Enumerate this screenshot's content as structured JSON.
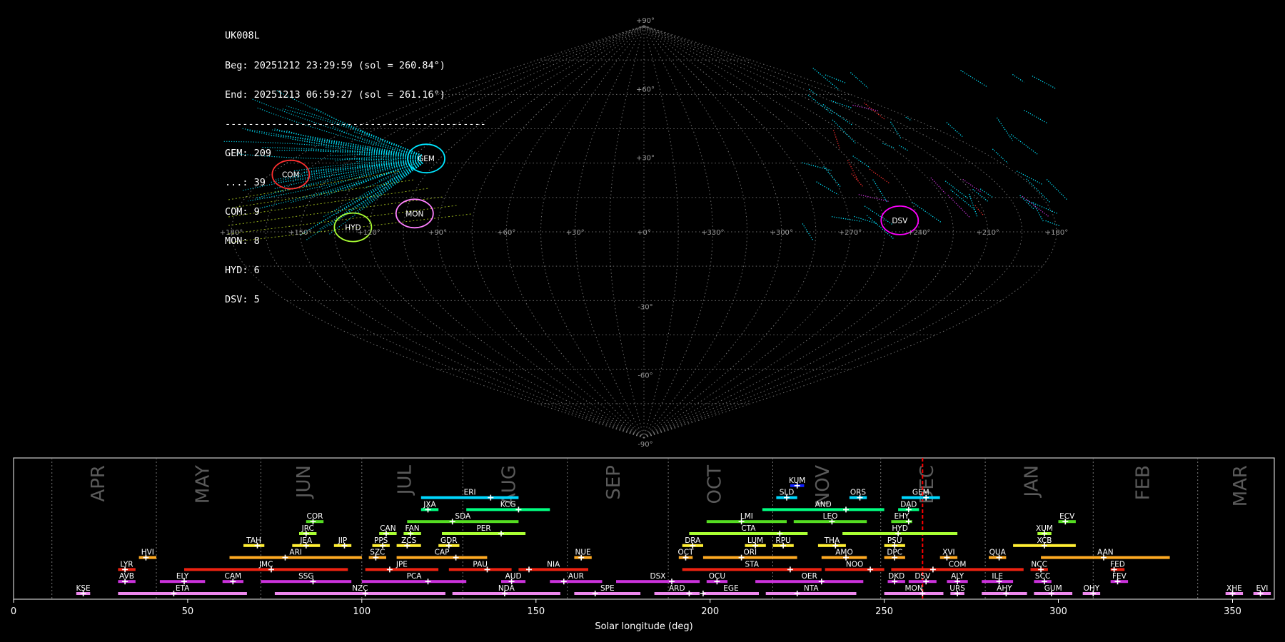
{
  "info": {
    "station": "UK008L",
    "begin": "Beg: 20251212 23:29:59 (sol = 260.84°)",
    "end": "End: 20251213 06:59:27 (sol = 261.16°)",
    "separator": "---------------------------------------------",
    "counts": [
      "GEM: 209",
      "...: 39",
      "COM: 9",
      "MON: 8",
      "HYD: 6",
      "DSV: 5"
    ]
  },
  "colors": {
    "background": "#000000",
    "grid": "#808080",
    "sporadic": "#00e5ff",
    "current_marker": "#ff0000",
    "text": "#ffffff",
    "month": "#5a5a5a"
  },
  "chart_data": [
    {
      "type": "scatter",
      "projection": "sinusoidal",
      "lon_labels": [
        "+180°",
        "+150°",
        "+120°",
        "+90°",
        "+60°",
        "+30°",
        "+0°",
        "+330°",
        "+300°",
        "+270°",
        "+240°",
        "+210°",
        "+180°"
      ],
      "lat_labels": [
        "+90°",
        "+60°",
        "+30°",
        "-30°",
        "-60°",
        "-90°"
      ],
      "radiants": [
        {
          "code": "COM",
          "ra": 170,
          "dec": 25,
          "color": "#ff3030"
        },
        {
          "code": "GEM",
          "ra": 112,
          "dec": 32,
          "color": "#00e5ff"
        },
        {
          "code": "MON",
          "ra": 101,
          "dec": 8,
          "color": "#ff80ff"
        },
        {
          "code": "HYD",
          "ra": 127,
          "dec": 2,
          "color": "#aaff33"
        },
        {
          "code": "DSV",
          "ra": 248,
          "dec": 5,
          "color": "#ff00ff"
        }
      ]
    },
    {
      "type": "bar",
      "xlabel": "Solar longitude (deg)",
      "xlim": [
        0,
        362
      ],
      "xticks": [
        0,
        50,
        100,
        150,
        200,
        250,
        300,
        350
      ],
      "current_sol": 261,
      "months": [
        {
          "name": "APR",
          "sol": 24
        },
        {
          "name": "MAY",
          "sol": 54
        },
        {
          "name": "JUN",
          "sol": 83
        },
        {
          "name": "JUL",
          "sol": 112
        },
        {
          "name": "AUG",
          "sol": 142
        },
        {
          "name": "SEP",
          "sol": 172
        },
        {
          "name": "OCT",
          "sol": 201
        },
        {
          "name": "NOV",
          "sol": 232
        },
        {
          "name": "DEC",
          "sol": 262
        },
        {
          "name": "JAN",
          "sol": 292
        },
        {
          "name": "FEB",
          "sol": 324
        },
        {
          "name": "MAR",
          "sol": 352
        }
      ],
      "month_bounds": [
        11,
        41,
        71,
        100,
        129,
        159,
        188,
        218,
        249,
        279,
        310,
        340
      ],
      "showers": [
        {
          "code": "KUM",
          "start": 223,
          "end": 227,
          "peak": 225,
          "row": 10,
          "color": "#1020ff"
        },
        {
          "code": "ERI",
          "start": 117,
          "end": 145,
          "peak": 137,
          "row": 9,
          "color": "#00d8ff"
        },
        {
          "code": "SLD",
          "start": 219,
          "end": 225,
          "peak": 222,
          "row": 9,
          "color": "#00d8ff"
        },
        {
          "code": "ORS",
          "start": 240,
          "end": 245,
          "peak": 243,
          "row": 9,
          "color": "#00d8ff"
        },
        {
          "code": "GEM",
          "start": 255,
          "end": 266,
          "peak": 262,
          "row": 9,
          "color": "#00d8ff"
        },
        {
          "code": "JXA",
          "start": 117,
          "end": 122,
          "peak": 119,
          "row": 8,
          "color": "#00ff80"
        },
        {
          "code": "KCG",
          "start": 130,
          "end": 154,
          "peak": 145,
          "row": 8,
          "color": "#00ff80"
        },
        {
          "code": "AND",
          "start": 215,
          "end": 250,
          "peak": 239,
          "row": 8,
          "color": "#00ff80"
        },
        {
          "code": "DAD",
          "start": 254,
          "end": 260,
          "peak": 257,
          "row": 8,
          "color": "#00ff80"
        },
        {
          "code": "COR",
          "start": 84,
          "end": 89,
          "peak": 86,
          "row": 7,
          "color": "#55dd22"
        },
        {
          "code": "SDA",
          "start": 113,
          "end": 145,
          "peak": 126,
          "row": 7,
          "color": "#55dd22"
        },
        {
          "code": "LMI",
          "start": 199,
          "end": 222,
          "peak": 209,
          "row": 7,
          "color": "#55dd22"
        },
        {
          "code": "LEO",
          "start": 224,
          "end": 245,
          "peak": 235,
          "row": 7,
          "color": "#55dd22"
        },
        {
          "code": "EHY",
          "start": 252,
          "end": 258,
          "peak": 257,
          "row": 7,
          "color": "#55dd22"
        },
        {
          "code": "ECV",
          "start": 300,
          "end": 305,
          "peak": 302,
          "row": 7,
          "color": "#55dd22"
        },
        {
          "code": "JRC",
          "start": 82,
          "end": 87,
          "peak": 84,
          "row": 6,
          "color": "#aaff33"
        },
        {
          "code": "CAN",
          "start": 105,
          "end": 110,
          "peak": 107,
          "row": 6,
          "color": "#aaff33"
        },
        {
          "code": "FAN",
          "start": 112,
          "end": 117,
          "peak": 114,
          "row": 6,
          "color": "#aaff33"
        },
        {
          "code": "PER",
          "start": 123,
          "end": 147,
          "peak": 140,
          "row": 6,
          "color": "#aaff33"
        },
        {
          "code": "CTA",
          "start": 194,
          "end": 228,
          "peak": 220,
          "row": 6,
          "color": "#aaff33"
        },
        {
          "code": "HYD",
          "start": 238,
          "end": 271,
          "peak": 254,
          "row": 6,
          "color": "#aaff33"
        },
        {
          "code": "XUM",
          "start": 294,
          "end": 298,
          "peak": 296,
          "row": 6,
          "color": "#aaff33"
        },
        {
          "code": "TAH",
          "start": 66,
          "end": 72,
          "peak": 70,
          "row": 5,
          "color": "#ffee33"
        },
        {
          "code": "JEA",
          "start": 80,
          "end": 88,
          "peak": 84,
          "row": 5,
          "color": "#ffee33"
        },
        {
          "code": "JIP",
          "start": 92,
          "end": 97,
          "peak": 95,
          "row": 5,
          "color": "#ffee33"
        },
        {
          "code": "PPS",
          "start": 103,
          "end": 108,
          "peak": 106,
          "row": 5,
          "color": "#ffee33"
        },
        {
          "code": "ZCS",
          "start": 110,
          "end": 117,
          "peak": 113,
          "row": 5,
          "color": "#ffee33"
        },
        {
          "code": "GDR",
          "start": 122,
          "end": 128,
          "peak": 125,
          "row": 5,
          "color": "#ffee33"
        },
        {
          "code": "DRA",
          "start": 192,
          "end": 198,
          "peak": 195,
          "row": 5,
          "color": "#ffee33"
        },
        {
          "code": "LUM",
          "start": 210,
          "end": 216,
          "peak": 213,
          "row": 5,
          "color": "#ffee33"
        },
        {
          "code": "RPU",
          "start": 218,
          "end": 224,
          "peak": 221,
          "row": 5,
          "color": "#ffee33"
        },
        {
          "code": "THA",
          "start": 231,
          "end": 239,
          "peak": 236,
          "row": 5,
          "color": "#ffee33"
        },
        {
          "code": "PSU",
          "start": 250,
          "end": 256,
          "peak": 253,
          "row": 5,
          "color": "#ffee33"
        },
        {
          "code": "XCB",
          "start": 287,
          "end": 305,
          "peak": 296,
          "row": 5,
          "color": "#ffee33"
        },
        {
          "code": "HVI",
          "start": 36,
          "end": 41,
          "peak": 38,
          "row": 4,
          "color": "#ffaa22"
        },
        {
          "code": "ARI",
          "start": 62,
          "end": 100,
          "peak": 78,
          "row": 4,
          "color": "#ffaa22"
        },
        {
          "code": "SZC",
          "start": 102,
          "end": 107,
          "peak": 104,
          "row": 4,
          "color": "#ffaa22"
        },
        {
          "code": "CAP",
          "start": 110,
          "end": 136,
          "peak": 127,
          "row": 4,
          "color": "#ffaa22"
        },
        {
          "code": "NUE",
          "start": 161,
          "end": 166,
          "peak": 163,
          "row": 4,
          "color": "#ffaa22"
        },
        {
          "code": "OCT",
          "start": 191,
          "end": 195,
          "peak": 193,
          "row": 4,
          "color": "#ffaa22"
        },
        {
          "code": "ORI",
          "start": 198,
          "end": 225,
          "peak": 209,
          "row": 4,
          "color": "#ffaa22"
        },
        {
          "code": "AMO",
          "start": 232,
          "end": 245,
          "peak": 239,
          "row": 4,
          "color": "#ffaa22"
        },
        {
          "code": "DPC",
          "start": 250,
          "end": 256,
          "peak": 253,
          "row": 4,
          "color": "#ffaa22"
        },
        {
          "code": "XVI",
          "start": 266,
          "end": 271,
          "peak": 268,
          "row": 4,
          "color": "#ffaa22"
        },
        {
          "code": "QUA",
          "start": 280,
          "end": 285,
          "peak": 283,
          "row": 4,
          "color": "#ffaa22"
        },
        {
          "code": "AAN",
          "start": 295,
          "end": 332,
          "peak": 313,
          "row": 4,
          "color": "#ffaa22"
        },
        {
          "code": "LYR",
          "start": 30,
          "end": 35,
          "peak": 32,
          "row": 3,
          "color": "#ee2211"
        },
        {
          "code": "JMC",
          "start": 49,
          "end": 96,
          "peak": 74,
          "row": 3,
          "color": "#ee2211"
        },
        {
          "code": "JPE",
          "start": 101,
          "end": 122,
          "peak": 108,
          "row": 3,
          "color": "#ee2211"
        },
        {
          "code": "PAU",
          "start": 125,
          "end": 143,
          "peak": 136,
          "row": 3,
          "color": "#ee2211"
        },
        {
          "code": "NIA",
          "start": 145,
          "end": 165,
          "peak": 148,
          "row": 3,
          "color": "#ee2211"
        },
        {
          "code": "STA",
          "start": 192,
          "end": 232,
          "peak": 223,
          "row": 3,
          "color": "#ee2211"
        },
        {
          "code": "NOO",
          "start": 233,
          "end": 250,
          "peak": 246,
          "row": 3,
          "color": "#ee2211"
        },
        {
          "code": "COM",
          "start": 252,
          "end": 290,
          "peak": 264,
          "row": 3,
          "color": "#ee2211"
        },
        {
          "code": "NCC",
          "start": 292,
          "end": 297,
          "peak": 295,
          "row": 3,
          "color": "#ee2211"
        },
        {
          "code": "FED",
          "start": 315,
          "end": 319,
          "peak": 316,
          "row": 3,
          "color": "#ee2211"
        },
        {
          "code": "AVB",
          "start": 30,
          "end": 35,
          "peak": 32,
          "row": 2,
          "color": "#cc33dd"
        },
        {
          "code": "ELY",
          "start": 42,
          "end": 55,
          "peak": 49,
          "row": 2,
          "color": "#cc33dd"
        },
        {
          "code": "CAM",
          "start": 60,
          "end": 66,
          "peak": 63,
          "row": 2,
          "color": "#cc33dd"
        },
        {
          "code": "SSG",
          "start": 71,
          "end": 97,
          "peak": 86,
          "row": 2,
          "color": "#cc33dd"
        },
        {
          "code": "PCA",
          "start": 100,
          "end": 130,
          "peak": 119,
          "row": 2,
          "color": "#cc33dd"
        },
        {
          "code": "AUD",
          "start": 140,
          "end": 147,
          "peak": 143,
          "row": 2,
          "color": "#cc33dd"
        },
        {
          "code": "AUR",
          "start": 154,
          "end": 169,
          "peak": 158,
          "row": 2,
          "color": "#cc33dd"
        },
        {
          "code": "DSX",
          "start": 173,
          "end": 197,
          "peak": 189,
          "row": 2,
          "color": "#cc33dd"
        },
        {
          "code": "OCU",
          "start": 199,
          "end": 205,
          "peak": 202,
          "row": 2,
          "color": "#cc33dd"
        },
        {
          "code": "OER",
          "start": 213,
          "end": 244,
          "peak": 232,
          "row": 2,
          "color": "#cc33dd"
        },
        {
          "code": "DKD",
          "start": 251,
          "end": 256,
          "peak": 253,
          "row": 2,
          "color": "#cc33dd"
        },
        {
          "code": "DSV",
          "start": 257,
          "end": 265,
          "peak": 262,
          "row": 2,
          "color": "#cc33dd"
        },
        {
          "code": "ALY",
          "start": 268,
          "end": 274,
          "peak": 271,
          "row": 2,
          "color": "#cc33dd"
        },
        {
          "code": "ILE",
          "start": 278,
          "end": 287,
          "peak": 283,
          "row": 2,
          "color": "#cc33dd"
        },
        {
          "code": "SCC",
          "start": 293,
          "end": 298,
          "peak": 296,
          "row": 2,
          "color": "#cc33dd"
        },
        {
          "code": "FEV",
          "start": 315,
          "end": 320,
          "peak": 317,
          "row": 2,
          "color": "#cc33dd"
        },
        {
          "code": "KSE",
          "start": 18,
          "end": 22,
          "peak": 20,
          "row": 1,
          "color": "#ee88ee"
        },
        {
          "code": "ETA",
          "start": 30,
          "end": 67,
          "peak": 46,
          "row": 1,
          "color": "#ee88ee"
        },
        {
          "code": "NZC",
          "start": 75,
          "end": 124,
          "peak": 101,
          "row": 1,
          "color": "#ee88ee"
        },
        {
          "code": "NDA",
          "start": 126,
          "end": 157,
          "peak": 141,
          "row": 1,
          "color": "#ee88ee"
        },
        {
          "code": "SPE",
          "start": 161,
          "end": 180,
          "peak": 167,
          "row": 1,
          "color": "#ee88ee"
        },
        {
          "code": "ARD",
          "start": 184,
          "end": 197,
          "peak": 194,
          "row": 1,
          "color": "#ee88ee"
        },
        {
          "code": "EGE",
          "start": 198,
          "end": 214,
          "peak": 198,
          "row": 1,
          "color": "#ee88ee"
        },
        {
          "code": "NTA",
          "start": 216,
          "end": 242,
          "peak": 225,
          "row": 1,
          "color": "#ee88ee"
        },
        {
          "code": "MON",
          "start": 250,
          "end": 267,
          "peak": 261,
          "row": 1,
          "color": "#ee88ee"
        },
        {
          "code": "URS",
          "start": 269,
          "end": 273,
          "peak": 271,
          "row": 1,
          "color": "#ee88ee"
        },
        {
          "code": "AHY",
          "start": 278,
          "end": 291,
          "peak": 285,
          "row": 1,
          "color": "#ee88ee"
        },
        {
          "code": "GUM",
          "start": 293,
          "end": 304,
          "peak": 298,
          "row": 1,
          "color": "#ee88ee"
        },
        {
          "code": "OHY",
          "start": 307,
          "end": 312,
          "peak": 310,
          "row": 1,
          "color": "#ee88ee"
        },
        {
          "code": "XHE",
          "start": 348,
          "end": 353,
          "peak": 350,
          "row": 1,
          "color": "#ee88ee"
        },
        {
          "code": "EVI",
          "start": 356,
          "end": 361,
          "peak": 358,
          "row": 1,
          "color": "#ee88ee"
        }
      ]
    }
  ]
}
